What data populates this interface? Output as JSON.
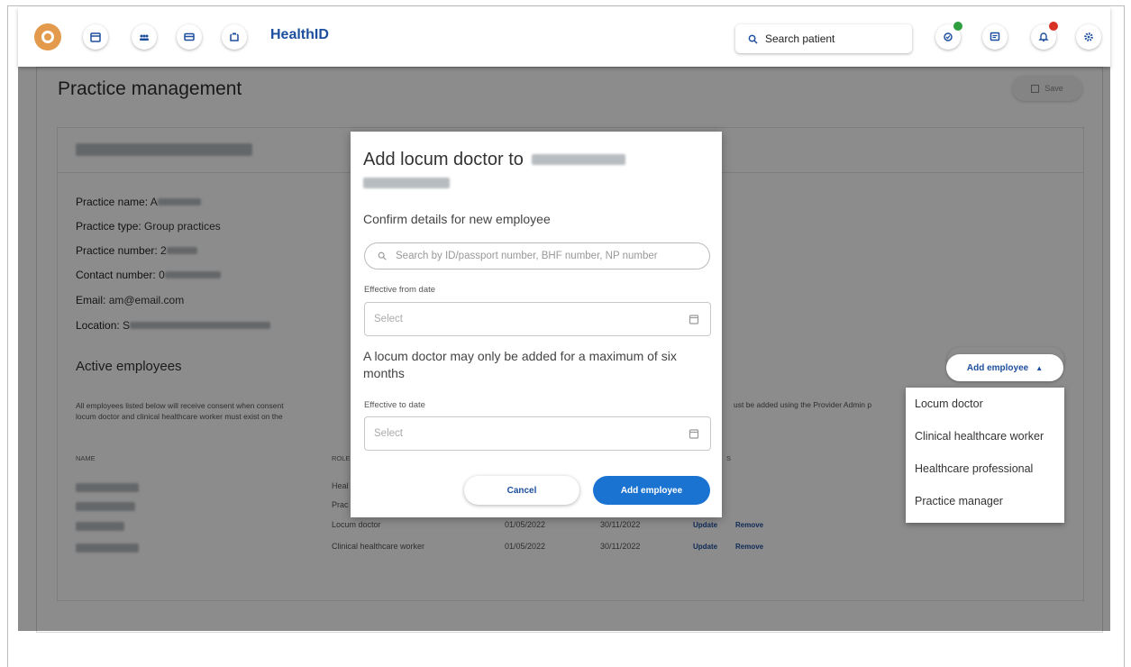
{
  "header": {
    "brand": "HealthID",
    "search_placeholder": "Search patient",
    "status_dot_green": "#2e9e3f",
    "status_dot_red": "#d93025"
  },
  "page": {
    "title": "Practice management",
    "save_label": "Save",
    "practice": {
      "name_label": "Practice name:",
      "name_value": "A",
      "type_label": "Practice type:",
      "type_value": "Group practices",
      "number_label": "Practice number:",
      "number_value": "2",
      "contact_label": "Contact number:",
      "contact_value": "0",
      "email_label": "Email:",
      "email_value": "am@email.com",
      "location_label": "Location:",
      "location_value": "S"
    },
    "active_employees_title": "Active employees",
    "note_line1": "All employees listed below will receive consent when consent",
    "note_line1_tail": "ust be added using the Provider Admin p",
    "note_line2": "locum doctor and clinical healthcare worker must exist on the",
    "table": {
      "col_name": "NAME",
      "col_role": "ROLE",
      "col_actions": "S",
      "rows": [
        {
          "role": "Heal",
          "from": "",
          "to": "",
          "update": "",
          "remove": ""
        },
        {
          "role": "Prac",
          "from": "",
          "to": "",
          "update": "",
          "remove": ""
        },
        {
          "role": "Locum doctor",
          "from": "01/05/2022",
          "to": "30/11/2022",
          "update": "Update",
          "remove": "Remove"
        },
        {
          "role": "Clinical healthcare worker",
          "from": "01/05/2022",
          "to": "30/11/2022",
          "update": "Update",
          "remove": "Remove"
        }
      ]
    },
    "add_employee_label": "Add employee"
  },
  "dropdown": {
    "items": [
      "Locum doctor",
      "Clinical healthcare worker",
      "Healthcare professional",
      "Practice manager"
    ]
  },
  "modal": {
    "title": "Add locum doctor to",
    "subtitle": "Confirm details for new employee",
    "search_placeholder": "Search by ID/passport number, BHF number, NP number",
    "from_label": "Effective from date",
    "from_placeholder": "Select",
    "note": "A locum doctor may only be added for a maximum of six months",
    "to_label": "Effective to date",
    "to_placeholder": "Select",
    "cancel_label": "Cancel",
    "add_label": "Add employee"
  }
}
